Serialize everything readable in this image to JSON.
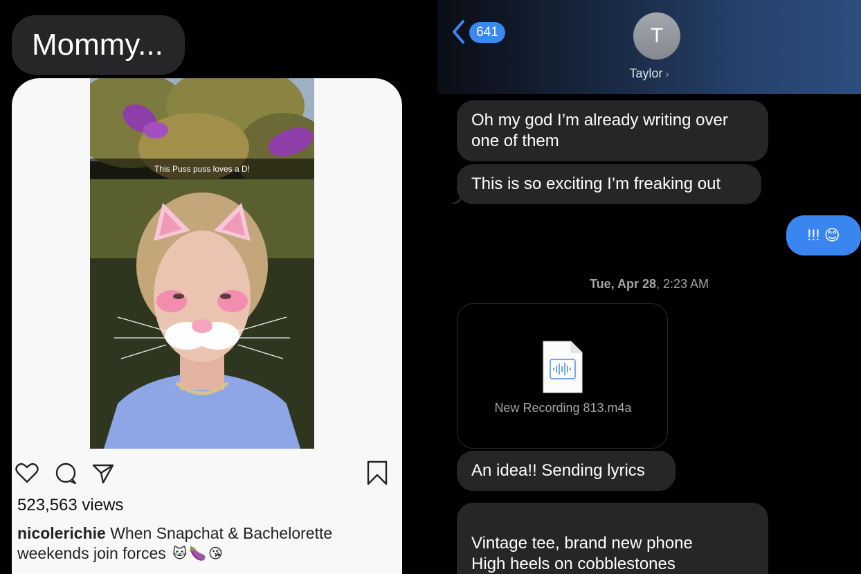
{
  "left": {
    "bubble_text": "Mommy...",
    "snap_caption": "This Puss puss loves a D!",
    "views": "523,563 views",
    "caption_user": "nicolerichie",
    "caption_text": "When Snapchat & Bachelorette weekends join forces",
    "caption_emojis": [
      "🐱",
      "🍆",
      "😘"
    ]
  },
  "right": {
    "unread_count": "641",
    "avatar_initial": "T",
    "contact_name": "Taylor",
    "messages": [
      "Oh my god I’m already writing over one of them",
      "This is so exciting I’m freaking out",
      "An idea!! Sending lyrics",
      "Vintage tee, brand new phone\nHigh heels on cobblestones\nWhen you are young they assume"
    ],
    "sent_message": "!!! 😊",
    "timestamp_bold": "Tue, Apr 28",
    "timestamp_rest": ", 2:23 AM",
    "file_name": "New Recording 813.m4a"
  },
  "colors": {
    "incoming_bubble": "#262629",
    "outgoing_bubble": "#3a86f0",
    "badge": "#3c87f0"
  }
}
